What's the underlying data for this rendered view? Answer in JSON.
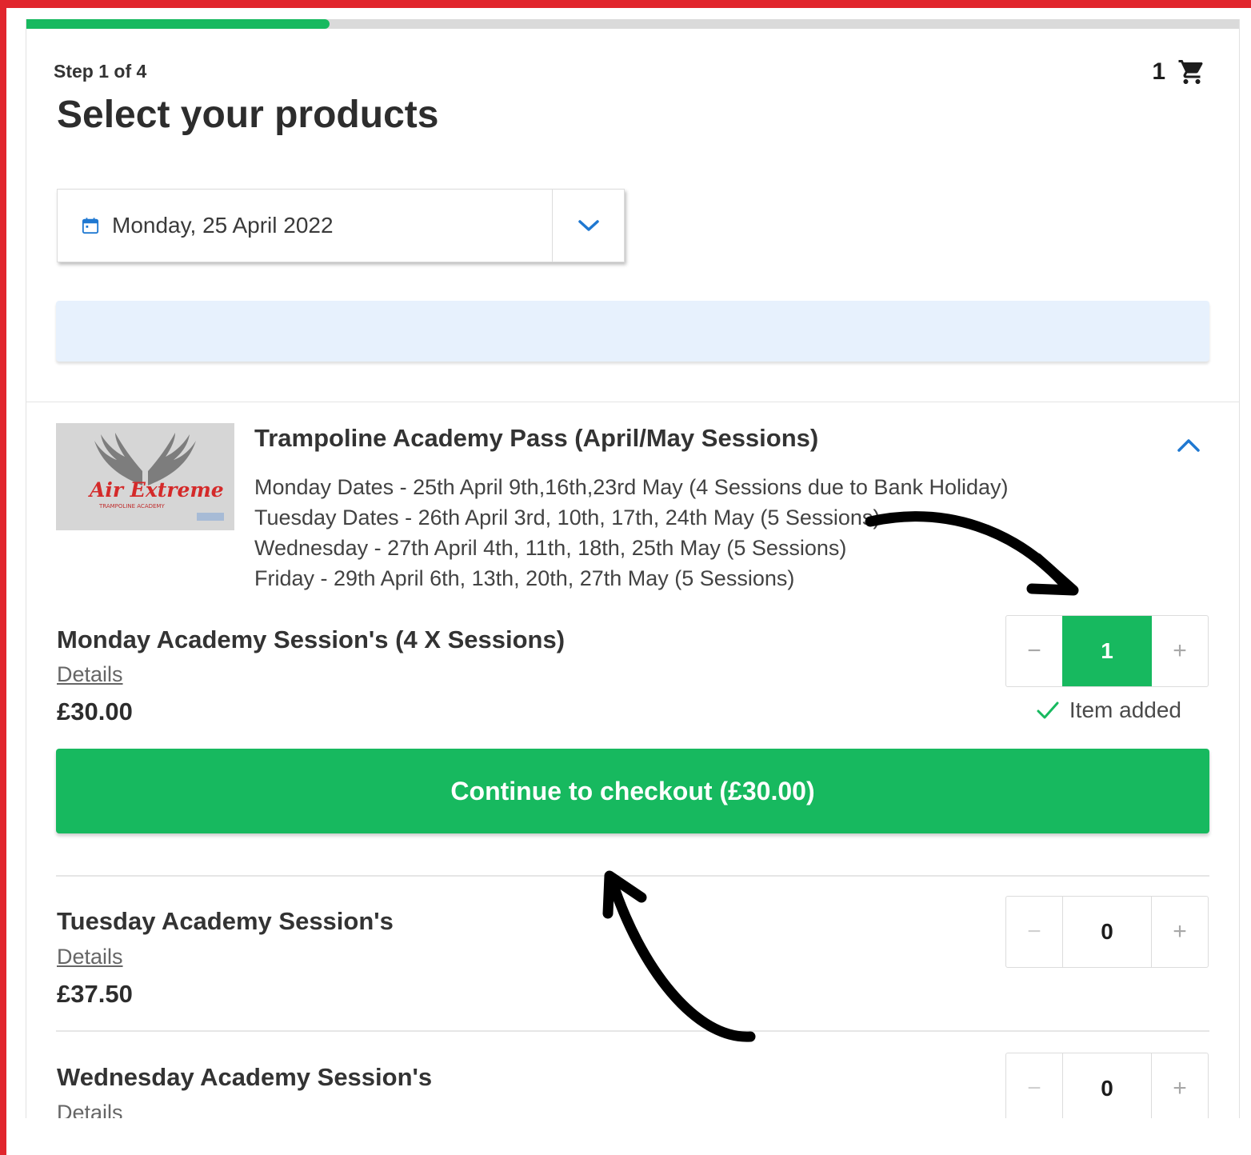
{
  "progress": {
    "value_percent": 25
  },
  "header": {
    "step_label": "Step 1 of 4",
    "title": "Select your products",
    "cart_count": "1"
  },
  "date_picker": {
    "value": "Monday, 25 April 2022"
  },
  "product": {
    "name": "Trampoline Academy Pass (April/May Sessions)",
    "description": [
      "Monday Dates - 25th April 9th,16th,23rd May (4 Sessions due to Bank Holiday)",
      "Tuesday Dates - 26th April 3rd, 10th, 17th, 24th May (5 Sessions)",
      "Wednesday - 27th April 4th, 11th, 18th, 25th May (5 Sessions)",
      "Friday - 29th April 6th, 13th, 20th, 27th May (5 Sessions)"
    ],
    "logo_text": "Air Extreme",
    "logo_subtext": "TRAMPOLINE ACADEMY"
  },
  "items": [
    {
      "name": "Monday Academy Session's (4 X Sessions)",
      "details_label": "Details",
      "price": "£30.00",
      "quantity": "1"
    },
    {
      "name": "Tuesday Academy Session's",
      "details_label": "Details",
      "price": "£37.50",
      "quantity": "0"
    },
    {
      "name": "Wednesday Academy Session's",
      "details_label": "Details",
      "quantity": "0"
    }
  ],
  "stepper": {
    "minus_label": "−",
    "plus_label": "+"
  },
  "item_added_label": "Item added",
  "checkout_label": "Continue to checkout (£30.00)",
  "colors": {
    "accent_green": "#17b95f",
    "frame_red": "#e1262d",
    "link_blue": "#1f78d1",
    "banner_blue": "#e7f1fd"
  },
  "icons": [
    "cart-icon",
    "calendar-icon",
    "chevron-down-icon",
    "chevron-up-icon",
    "check-icon"
  ]
}
